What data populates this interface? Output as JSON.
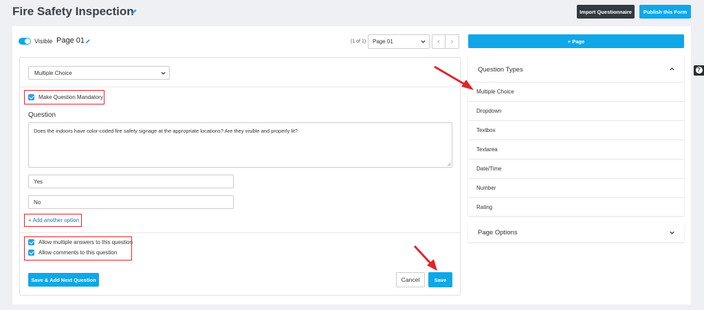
{
  "header": {
    "title": "Fire Safety Inspection",
    "import_label": "Import Questionnaire",
    "publish_label": "Publish this Form"
  },
  "page_bar": {
    "visible_label": "Visible",
    "page_name": "Page 01",
    "pager_count": "(1 of 1)",
    "page_select_value": "Page 01",
    "prev_glyph": "‹",
    "next_glyph": "›"
  },
  "question": {
    "type_value": "Multiple Choice",
    "mandatory_label": "Make Question Mandatory",
    "question_label": "Question",
    "question_text": "Does the indoors have color-coded fire safety signage at the appropriate locations? Are they visible and properly lit?",
    "options": [
      "Yes",
      "No"
    ],
    "add_option_label": "+ Add another option",
    "allow_multiple_label": "Allow multiple answers to this question",
    "allow_comments_label": "Allow comments to this question",
    "save_next_label": "Save & Add Next Question",
    "cancel_label": "Cancel",
    "save_label": "Save"
  },
  "sidebar": {
    "add_page_label": "+ Page",
    "question_types_title": "Question Types",
    "question_types": [
      "Multiple Choice",
      "Dropdown",
      "Textbox",
      "Textarea",
      "Date/Time",
      "Number",
      "Rating"
    ],
    "page_options_title": "Page Options"
  },
  "help_glyph": "?",
  "colors": {
    "accent": "#0fa7e8",
    "dark_button": "#333940",
    "highlight_red": "#e1242b",
    "link": "#1678c8"
  }
}
